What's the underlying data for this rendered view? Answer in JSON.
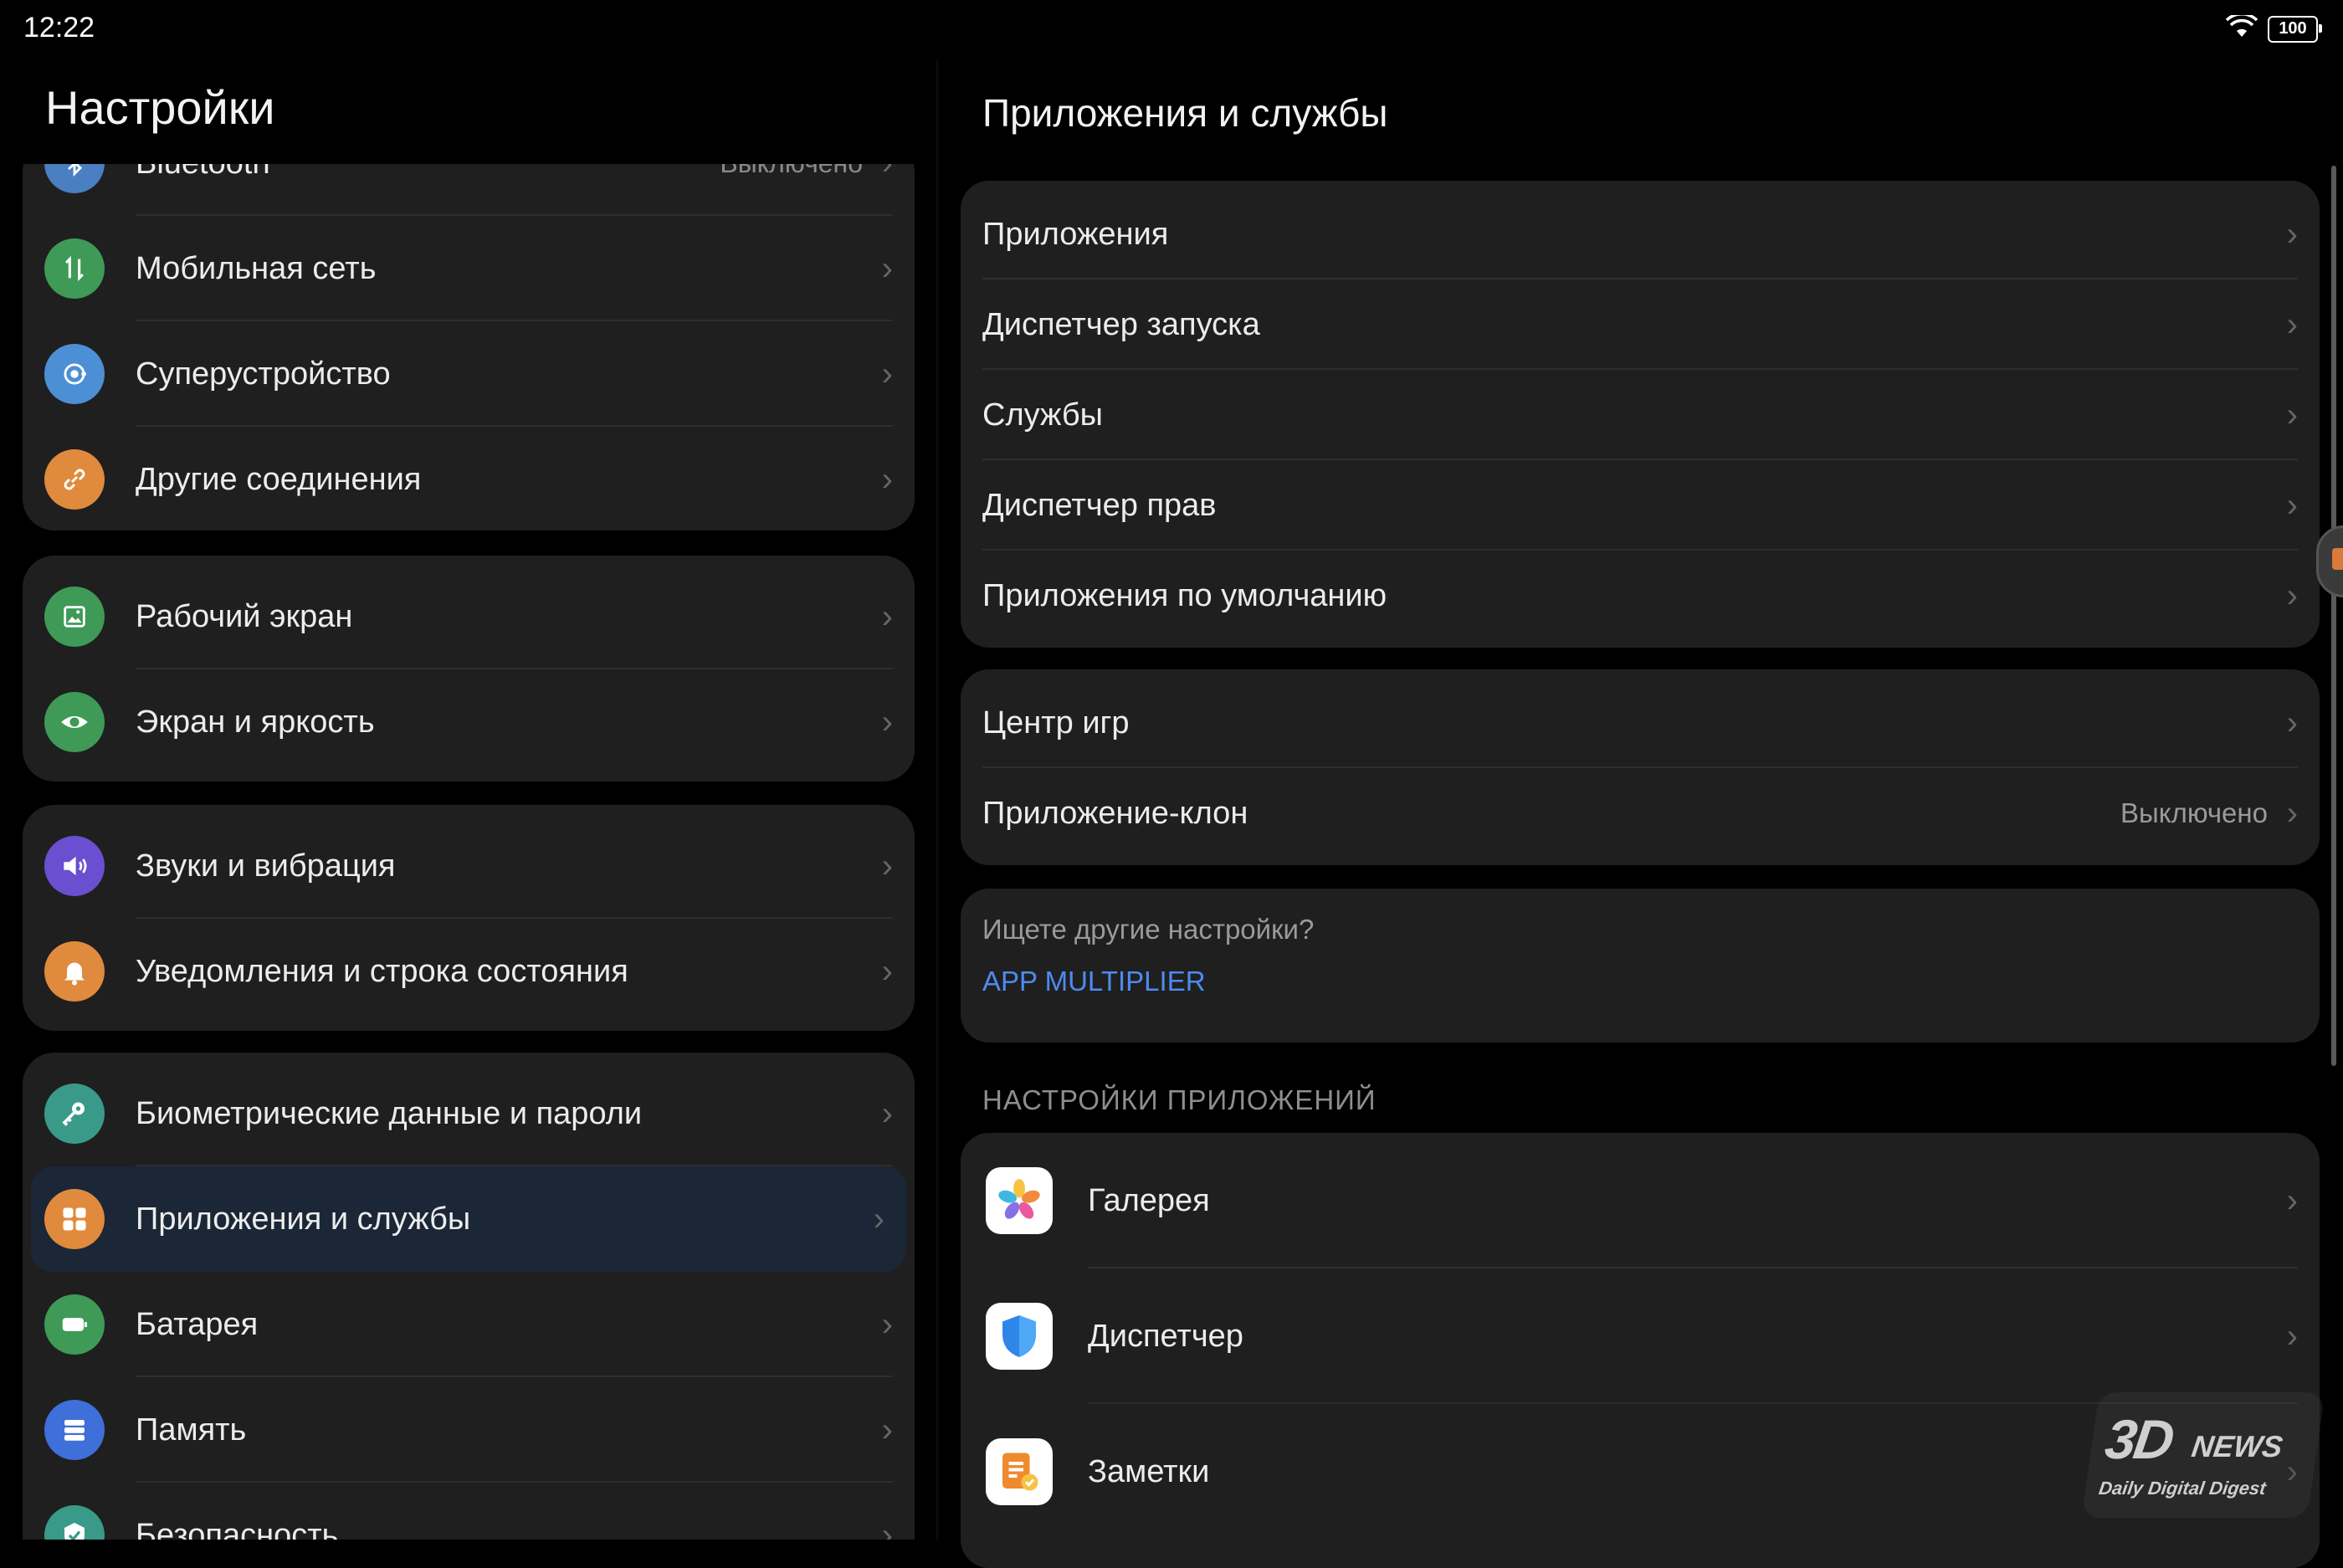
{
  "status": {
    "time": "12:22",
    "battery": "100"
  },
  "left": {
    "title": "Настройки",
    "cards": [
      {
        "items": [
          {
            "label": "Bluetooth",
            "value": "Выключено",
            "icon": "bluetooth-icon",
            "color": "#4a7fc1"
          },
          {
            "label": "Мобильная сеть",
            "icon": "mobile-network-icon",
            "color": "#3e9a56"
          },
          {
            "label": "Суперустройство",
            "icon": "super-device-icon",
            "color": "#4d8fd4"
          },
          {
            "label": "Другие соединения",
            "icon": "link-icon",
            "color": "#e08a3e"
          }
        ]
      },
      {
        "items": [
          {
            "label": "Рабочий экран",
            "icon": "home-screen-icon",
            "color": "#3e9a56"
          },
          {
            "label": "Экран и яркость",
            "icon": "eye-icon",
            "color": "#3e9a56"
          }
        ]
      },
      {
        "items": [
          {
            "label": "Звуки и вибрация",
            "icon": "sound-icon",
            "color": "#6a4fd0"
          },
          {
            "label": "Уведомления и строка состояния",
            "icon": "bell-icon",
            "color": "#e08a3e"
          }
        ]
      },
      {
        "items": [
          {
            "label": "Биометрические данные и пароли",
            "icon": "key-icon",
            "color": "#3a9a8a"
          },
          {
            "label": "Приложения и службы",
            "icon": "apps-icon",
            "color": "#e08a3e"
          },
          {
            "label": "Батарея",
            "icon": "battery-icon",
            "color": "#3e9a56"
          },
          {
            "label": "Память",
            "icon": "storage-icon",
            "color": "#3f6fd8"
          },
          {
            "label": "Безопасность",
            "icon": "shield-check-icon",
            "color": "#3a9a8a"
          }
        ]
      }
    ]
  },
  "right": {
    "title": "Приложения и службы",
    "group1": [
      {
        "label": "Приложения"
      },
      {
        "label": "Диспетчер запуска"
      },
      {
        "label": "Службы"
      },
      {
        "label": "Диспетчер прав"
      },
      {
        "label": "Приложения по умолчанию"
      }
    ],
    "group2": [
      {
        "label": "Центр игр"
      },
      {
        "label": "Приложение-клон",
        "value": "Выключено"
      }
    ],
    "hint": {
      "question": "Ищете другие настройки?",
      "link": "APP MULTIPLIER"
    },
    "section_header": "НАСТРОЙКИ ПРИЛОЖЕНИЙ",
    "apps": [
      {
        "label": "Галерея",
        "icon": "gallery-icon"
      },
      {
        "label": "Диспетчер",
        "icon": "optimizer-shield-icon"
      },
      {
        "label": "Заметки",
        "icon": "notes-icon"
      }
    ]
  },
  "watermark": {
    "main": "3D",
    "news": "NEWS",
    "sub": "Daily Digital Digest"
  }
}
